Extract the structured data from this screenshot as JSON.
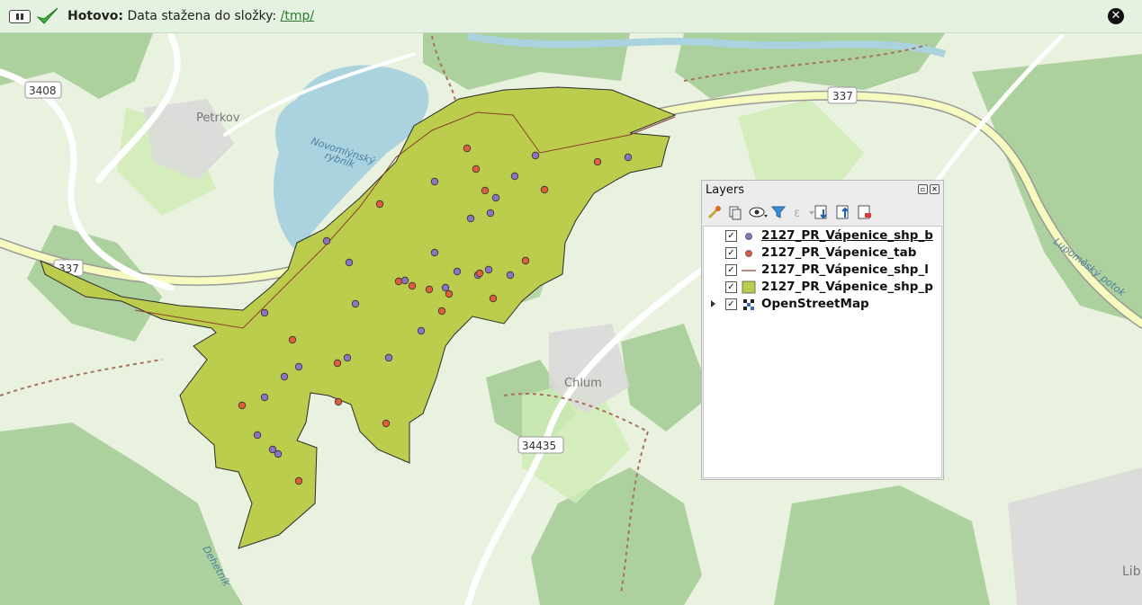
{
  "message_bar": {
    "status": "Hotovo:",
    "text": "Data stažena do složky:",
    "link": "/tmp/"
  },
  "map": {
    "labels": {
      "road_3408": "3408",
      "road_337_left": "337",
      "road_337_right": "337",
      "road_34435": "34435",
      "petrkov": "Petrkov",
      "pond_line1": "Novomlýnský",
      "pond_line2": "rybník",
      "chlum": "Chlum",
      "lupomesky": "Lupoměský potok",
      "dehetnik": "Dehetník",
      "lib": "Lib"
    },
    "colors": {
      "polygon": "#bccd4e",
      "point_blue": "#8f72c2",
      "point_red": "#e15d3a",
      "water": "#aad3df",
      "forest": "#add19e"
    }
  },
  "layers_panel": {
    "title": "Layers",
    "items": [
      {
        "label": "2127_PR_Vápenice_shp_b",
        "checked": true,
        "symbol": "point-purple",
        "color": "#8f72c2"
      },
      {
        "label": "2127_PR_Vápenice_tab",
        "checked": true,
        "symbol": "point-red",
        "color": "#e15d3a"
      },
      {
        "label": "2127_PR_Vápenice_shp_l",
        "checked": true,
        "symbol": "line",
        "color": "#8a3d2a"
      },
      {
        "label": "2127_PR_Vápenice_shp_p",
        "checked": true,
        "symbol": "polygon",
        "color": "#bccd4e"
      },
      {
        "label": "OpenStreetMap",
        "checked": true,
        "symbol": "raster"
      }
    ]
  }
}
